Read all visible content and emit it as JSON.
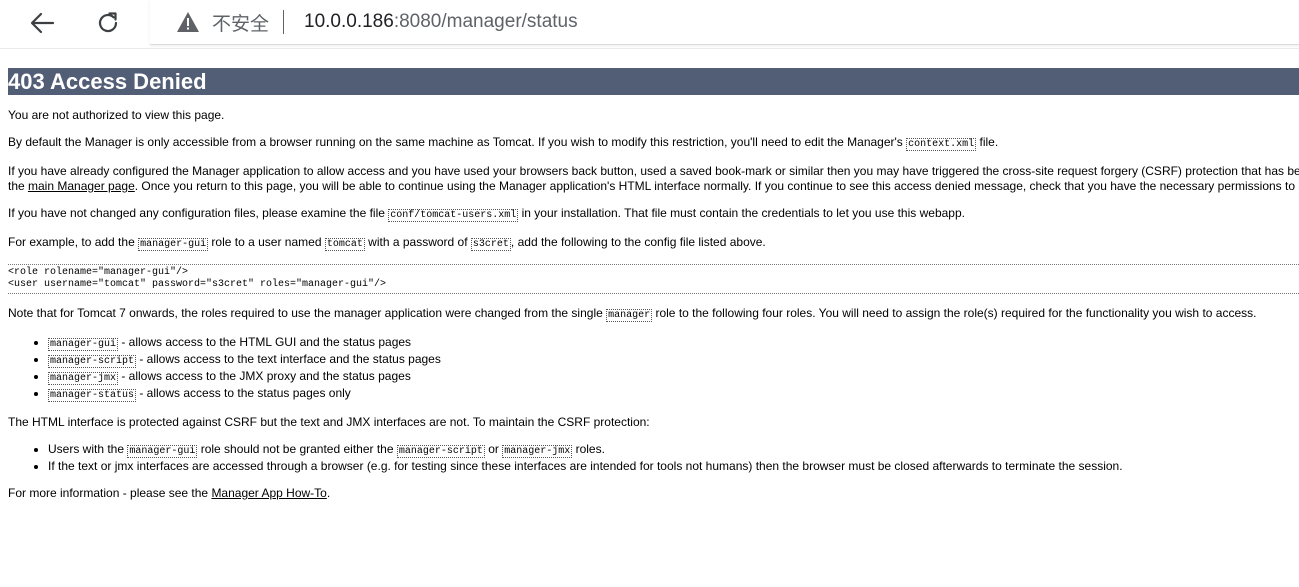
{
  "browser": {
    "back_icon": "arrow-left-icon",
    "reload_icon": "reload-icon",
    "warning_icon": "warning-triangle-icon",
    "insecure_label": "不安全",
    "url_host": "10.0.0.186",
    "url_rest": ":8080/manager/status"
  },
  "page": {
    "title": "403 Access Denied",
    "p_unauthorized": "You are not authorized to view this page.",
    "p_default_before": "By default the Manager is only accessible from a browser running on the same machine as Tomcat. If you wish to modify this restriction, you'll need to edit the Manager's ",
    "p_default_code": "context.xml",
    "p_default_after": " file.",
    "p_csrf_line1": "If you have already configured the Manager application to allow access and you have used your browsers back button, used a saved book-mark or similar then you may have triggered the cross-site request forgery (CSRF) protection that has be",
    "p_csrf_line2_before": "the ",
    "p_csrf_link": "main Manager page",
    "p_csrf_line2_after": ". Once you return to this page, you will be able to continue using the Manager application's HTML interface normally. If you continue to see this access denied message, check that you have the necessary permissions to a",
    "p_config_before": "If you have not changed any configuration files, please examine the file ",
    "p_config_code": "conf/tomcat-users.xml",
    "p_config_after": " in your installation. That file must contain the credentials to let you use this webapp.",
    "p_example_1": "For example, to add the ",
    "p_example_code1": "manager-gui",
    "p_example_2": " role to a user named ",
    "p_example_code2": "tomcat",
    "p_example_3": " with a password of ",
    "p_example_code3": "s3cret",
    "p_example_4": ", add the following to the config file listed above.",
    "example_block": "<role rolename=\"manager-gui\"/>\n<user username=\"tomcat\" password=\"s3cret\" roles=\"manager-gui\"/>",
    "p_note_before": "Note that for Tomcat 7 onwards, the roles required to use the manager application were changed from the single ",
    "p_note_code": "manager",
    "p_note_after": " role to the following four roles. You will need to assign the role(s) required for the functionality you wish to access.",
    "roles": [
      {
        "code": "manager-gui",
        "desc": " - allows access to the HTML GUI and the status pages"
      },
      {
        "code": "manager-script",
        "desc": " - allows access to the text interface and the status pages"
      },
      {
        "code": "manager-jmx",
        "desc": " - allows access to the JMX proxy and the status pages"
      },
      {
        "code": "manager-status",
        "desc": " - allows access to the status pages only"
      }
    ],
    "p_csrf_protect": "The HTML interface is protected against CSRF but the text and JMX interfaces are not. To maintain the CSRF protection:",
    "csrf_item1_before": "Users with the ",
    "csrf_item1_code1": "manager-gui",
    "csrf_item1_mid": " role should not be granted either the ",
    "csrf_item1_code2": "manager-script",
    "csrf_item1_or": " or ",
    "csrf_item1_code3": "manager-jmx",
    "csrf_item1_after": " roles.",
    "csrf_item2": "If the text or jmx interfaces are accessed through a browser (e.g. for testing since these interfaces are intended for tools not humans) then the browser must be closed afterwards to terminate the session.",
    "p_more_before": "For more information - please see the ",
    "p_more_link": "Manager App How-To",
    "p_more_after": "."
  }
}
